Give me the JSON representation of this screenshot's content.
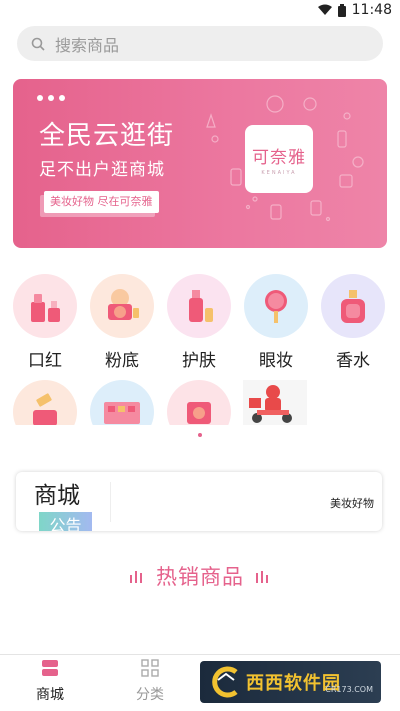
{
  "status_bar": {
    "time": "11:48"
  },
  "search": {
    "placeholder": "搜索商品"
  },
  "banner": {
    "title": "全民云逛街",
    "subtitle": "足不出户逛商城",
    "tag": "美妆好物 尽在可奈雅",
    "logo_text": "可奈雅",
    "logo_subtext": "KENAIYA"
  },
  "categories": [
    {
      "label": "口红",
      "icon": "lipstick-icon"
    },
    {
      "label": "粉底",
      "icon": "foundation-icon"
    },
    {
      "label": "护肤",
      "icon": "skincare-icon"
    },
    {
      "label": "眼妆",
      "icon": "eye-makeup-icon"
    },
    {
      "label": "香水",
      "icon": "perfume-icon"
    }
  ],
  "categories_row2": [
    {
      "icon": "cream-jar-icon"
    },
    {
      "icon": "eyeshadow-palette-icon"
    },
    {
      "icon": "compact-powder-icon"
    },
    {
      "icon": "delivery-rider-icon"
    }
  ],
  "notice": {
    "title": "商城",
    "badge": "公告",
    "text": "美妆好物"
  },
  "hot": {
    "title": "热销商品"
  },
  "bottom_nav": [
    {
      "label": "商城",
      "icon": "store-icon",
      "active": true
    },
    {
      "label": "分类",
      "icon": "grid-icon",
      "active": false
    }
  ],
  "watermark": {
    "text": "西西软件园",
    "url": "CR173.COM"
  },
  "colors": {
    "accent": "#e5628c",
    "banner": "#ec78a0",
    "search_bg": "#eeeeee"
  }
}
